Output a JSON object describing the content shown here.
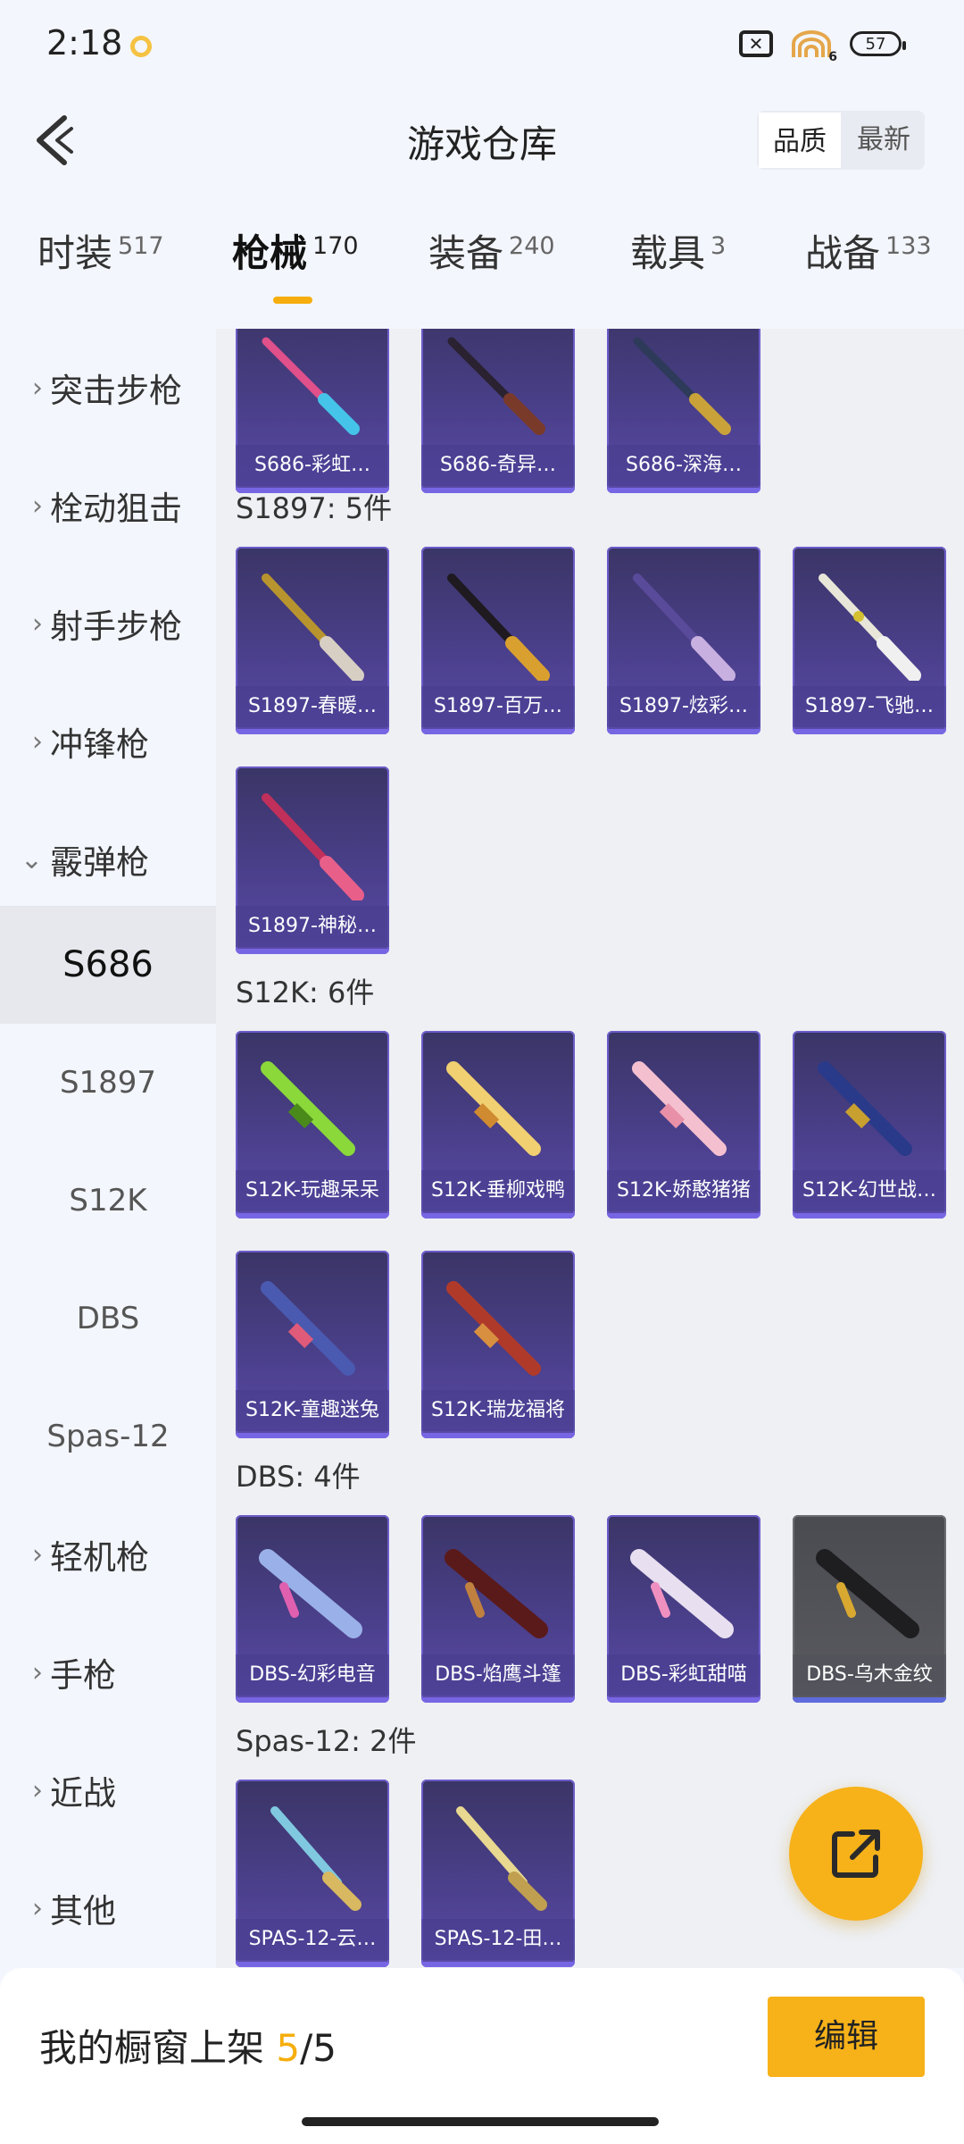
{
  "status": {
    "time": "2:18",
    "battery": "57",
    "signal_badge": "6"
  },
  "header": {
    "title": "游戏仓库",
    "sort_options": [
      "品质",
      "最新"
    ]
  },
  "categories": [
    {
      "label": "时装",
      "count": "517"
    },
    {
      "label": "枪械",
      "count": "170"
    },
    {
      "label": "装备",
      "count": "240"
    },
    {
      "label": "载具",
      "count": "3"
    },
    {
      "label": "战备",
      "count": "133"
    }
  ],
  "sidebar": {
    "groups": [
      "突击步枪",
      "栓动狙击",
      "射手步枪",
      "冲锋枪",
      "霰弹枪"
    ],
    "subitems": [
      "S686",
      "S1897",
      "S12K",
      "DBS",
      "Spas-12"
    ],
    "groups_after": [
      "轻机枪",
      "手枪",
      "近战",
      "其他"
    ]
  },
  "main": {
    "s686_items": [
      "S686-彩虹…",
      "S686-奇异…",
      "S686-深海…"
    ],
    "s1897_title": "S1897: 5件",
    "s1897_items": [
      "S1897-春暖…",
      "S1897-百万…",
      "S1897-炫彩…",
      "S1897-飞驰…",
      "S1897-神秘…"
    ],
    "s12k_title": "S12K: 6件",
    "s12k_items": [
      "S12K-玩趣呆呆",
      "S12K-垂柳戏鸭",
      "S12K-娇憨猪猪",
      "S12K-幻世战…",
      "S12K-童趣迷兔",
      "S12K-瑞龙福将"
    ],
    "dbs_title": "DBS: 4件",
    "dbs_items": [
      "DBS-幻彩电音",
      "DBS-焰鹰斗篷",
      "DBS-彩虹甜喵",
      "DBS-乌木金纹"
    ],
    "spas_title": "Spas-12: 2件",
    "spas_items": [
      "SPAS-12-云…",
      "SPAS-12-田…"
    ]
  },
  "bottom": {
    "shelf_label": "我的橱窗上架",
    "shelf_current": "5",
    "shelf_total": "/5",
    "edit_label": "编辑"
  },
  "colors": {
    "accent": "#f7b119",
    "card_purple": "#4a3f8a",
    "card_gray": "#55565c"
  },
  "icons": [
    "back-arrow-icon",
    "share-external-icon"
  ]
}
